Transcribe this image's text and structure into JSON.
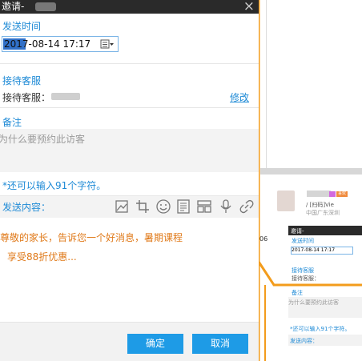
{
  "dialog": {
    "title": "邀请-",
    "close_icon": "close-icon",
    "send_time_label": "发送时间",
    "datetime_value": "2017-08-14 17:17",
    "reception_label": "接待客服",
    "staff_prefix": "接待客服：",
    "modify_link": "修改",
    "note_label": "备注",
    "note_placeholder": "为什么要预约此访客",
    "char_hint": "*还可以输入91个字符。",
    "send_content_label": "发送内容：",
    "toolbar_icons": [
      "image-icon",
      "crop-icon",
      "emoji-icon",
      "template-icon",
      "layout-icon",
      "microphone-icon",
      "link-icon"
    ],
    "message_line1": "尊敬的家长，告诉您一个好消息，暑期课程",
    "message_line2": "享受88折优惠...",
    "confirm_button": "确定",
    "cancel_button": "取消"
  },
  "background_window": {
    "thumb_badge": "喜欢",
    "thumb_line1": "/ [扫码]Vie",
    "thumb_line2": "中国广东深圳",
    "thumb_title": "邀请-",
    "thumb_send_time": "发送时间",
    "thumb_datetime": "2017-08-14 17:17",
    "thumb_reception": "接待客服",
    "thumb_staff": "接待客服：",
    "thumb_note": "备注",
    "thumb_placeholder": "为什么要预约此访客",
    "thumb_hint": "*还可以输入91个字符。",
    "thumb_send": "发送内容：",
    "side_number": "06",
    "side_text": "点对"
  },
  "colors": {
    "accent_blue": "#1e8ad6",
    "button_blue": "#1e9be6",
    "orange": "#f39c1c",
    "message_orange": "#e07a1a",
    "titlebar": "#2a2a2a"
  }
}
